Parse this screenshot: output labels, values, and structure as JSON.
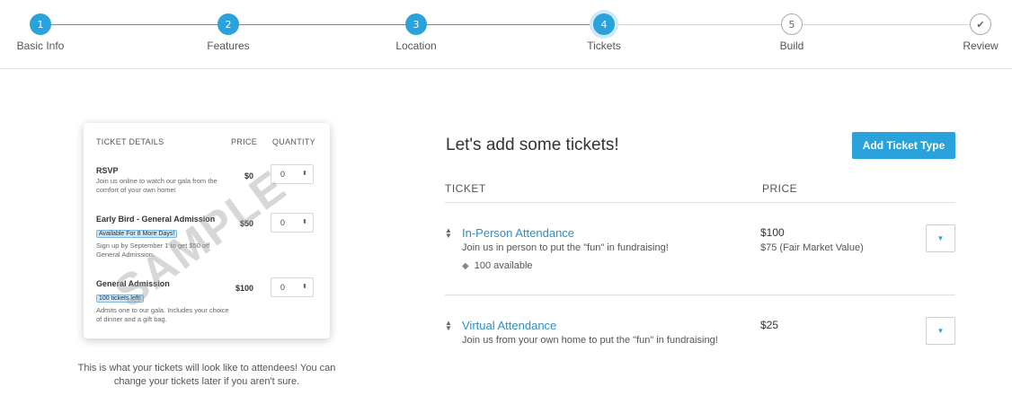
{
  "stepper": {
    "steps": [
      {
        "number": "1",
        "label": "Basic Info",
        "state": "done"
      },
      {
        "number": "2",
        "label": "Features",
        "state": "done"
      },
      {
        "number": "3",
        "label": "Location",
        "state": "done"
      },
      {
        "number": "4",
        "label": "Tickets",
        "state": "current"
      },
      {
        "number": "5",
        "label": "Build",
        "state": "todo"
      },
      {
        "number": "✔",
        "label": "Review",
        "state": "todo"
      }
    ],
    "accent": "#2aa3dc"
  },
  "preview": {
    "headers": {
      "details": "TICKET DETAILS",
      "price": "PRICE",
      "quantity": "QUANTITY"
    },
    "watermark": "SAMPLE",
    "tickets": [
      {
        "name": "RSVP",
        "badge": "",
        "desc": "Join us online to watch our gala from the comfort of your own home!",
        "price": "$0",
        "qty": "0"
      },
      {
        "name": "Early Bird - General Admission",
        "badge": "Available For 8 More Days!",
        "desc": "Sign up by September 1 to get $50 off General Admission.",
        "price": "$50",
        "qty": "0"
      },
      {
        "name": "General Admission",
        "badge": "100 tickets left!",
        "desc": "Admits one to our gala. Includes your choice of dinner and a gift bag.",
        "price": "$100",
        "qty": "0"
      }
    ],
    "caption": "This is what your tickets will look like to attendees! You can change your tickets later if you aren't sure."
  },
  "main": {
    "title": "Let's add some tickets!",
    "add_button": "Add Ticket Type",
    "columns": {
      "ticket": "TICKET",
      "price": "PRICE"
    },
    "tickets": [
      {
        "name": "In-Person Attendance",
        "desc": "Join us in person to put the \"fun\" in fundraising!",
        "availability": "100 available",
        "price": "$100",
        "fmv": "$75 (Fair Market Value)"
      },
      {
        "name": "Virtual Attendance",
        "desc": "Join us from your own home to put the \"fun\" in fundraising!",
        "availability": "",
        "price": "$25",
        "fmv": ""
      }
    ]
  }
}
